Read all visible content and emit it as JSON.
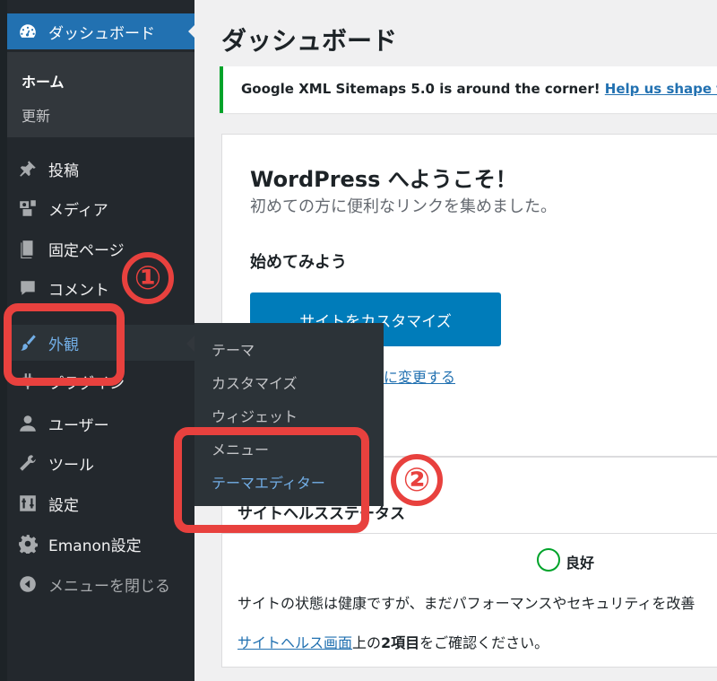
{
  "sidebar": {
    "dashboard": "ダッシュボード",
    "home": "ホーム",
    "update": "更新",
    "items": [
      {
        "label": "投稿",
        "icon": "pin-icon"
      },
      {
        "label": "メディア",
        "icon": "media-icon"
      },
      {
        "label": "固定ページ",
        "icon": "page-icon"
      },
      {
        "label": "コメント",
        "icon": "comment-icon"
      },
      {
        "label": "外観",
        "icon": "brush-icon"
      },
      {
        "label": "プラグイン",
        "icon": "plugin-icon"
      },
      {
        "label": "ユーザー",
        "icon": "user-icon"
      },
      {
        "label": "ツール",
        "icon": "wrench-icon"
      },
      {
        "label": "設定",
        "icon": "settings-icon"
      },
      {
        "label": "Emanon設定",
        "icon": "gear-icon"
      },
      {
        "label": "メニューを閉じる",
        "icon": "collapse-icon"
      }
    ]
  },
  "flyout": {
    "items": [
      "テーマ",
      "カスタマイズ",
      "ウィジェット",
      "メニュー",
      "テーマエディター"
    ]
  },
  "main": {
    "title": "ダッシュボード",
    "notice": {
      "text": "Google XML Sitemaps 5.0 is around the corner! ",
      "link": "Help us shape th"
    },
    "welcome": {
      "title": "WordPress へようこそ！",
      "subtitle": "初めての方に便利なリンクを集めました。",
      "heading": "始めてみよう",
      "button": "サイトをカスタマイズ",
      "link": "に変更する"
    },
    "health": {
      "title": "サイトヘルスステータス",
      "status": "良好",
      "description": "サイトの状態は健康ですが、まだパフォーマンスやセキュリティを改善",
      "link": "サイトヘルス画面",
      "link_suffix_1": "上の",
      "link_suffix_bold": "2項目",
      "link_suffix_2": "をご確認ください。"
    }
  },
  "annotations": {
    "one": "①",
    "two": "②"
  },
  "colors": {
    "sidebar_bg": "#23282d",
    "accent": "#2271b1",
    "active_link": "#72aee6",
    "annotation_red": "#e8413e",
    "health_good": "#00a32a"
  }
}
